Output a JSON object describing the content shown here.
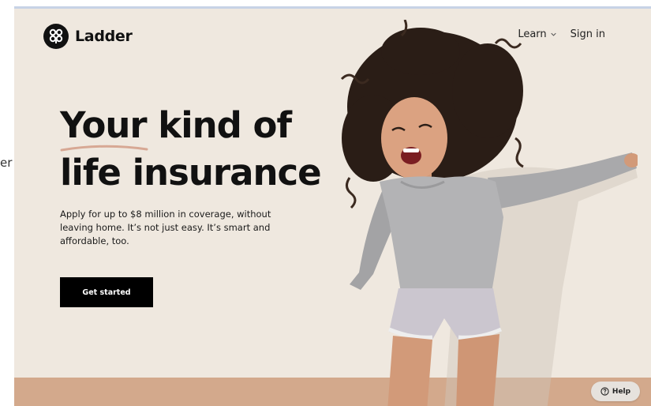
{
  "background_text": "er",
  "brand": {
    "name": "Ladder",
    "logo_icon": "ladder-knot-logo-icon"
  },
  "nav": {
    "learn_label": "Learn",
    "learn_icon": "chevron-down-icon",
    "signin_label": "Sign in"
  },
  "hero": {
    "headline_word1": "Your",
    "headline_rest_line1": " kind of",
    "headline_line2": "life insurance",
    "subtext": "Apply for up to $8 million in coverage, without leaving home. It’s not just easy. It’s smart and affordable, too.",
    "cta_label": "Get started",
    "image": "jumping-woman-photo"
  },
  "help": {
    "label": "Help",
    "icon": "question-circle-icon"
  },
  "colors": {
    "page_bg": "#efe8df",
    "band": "#d3a98c",
    "accent_underline": "#d7a894",
    "text": "#111111",
    "button_bg": "#000000"
  }
}
